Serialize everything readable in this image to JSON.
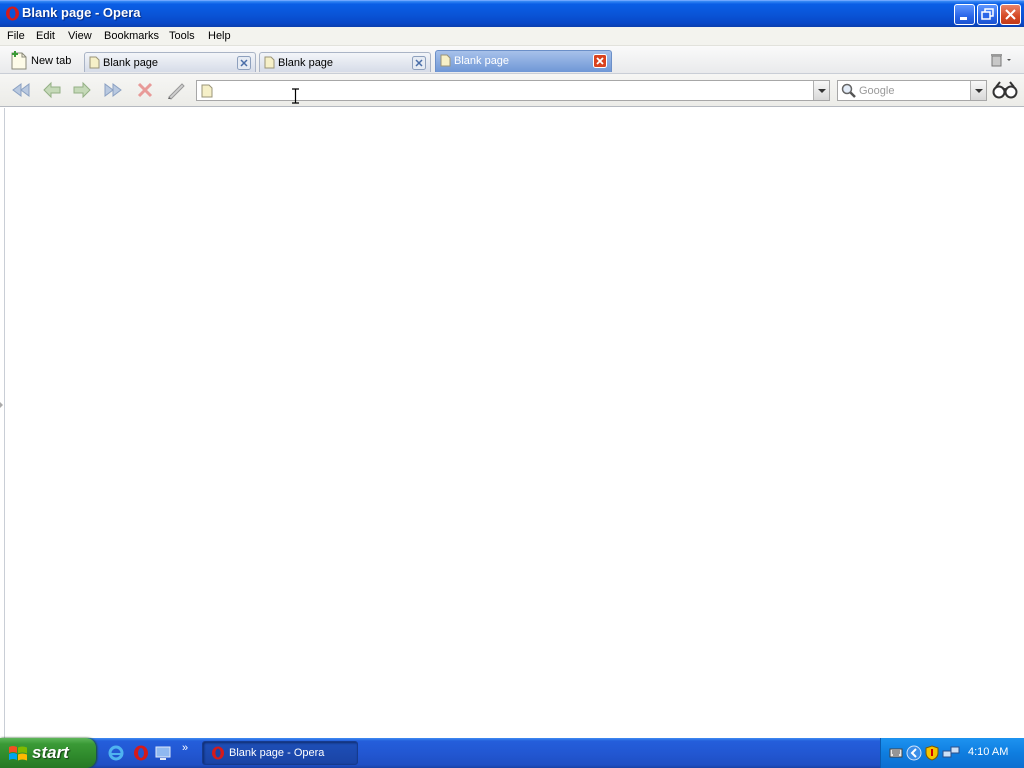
{
  "window": {
    "title": "Blank page - Opera",
    "icons": [
      "opera-logo-icon",
      "minimize-icon",
      "restore-icon",
      "close-icon"
    ]
  },
  "menu": {
    "items": [
      "File",
      "Edit",
      "View",
      "Bookmarks",
      "Tools",
      "Help"
    ]
  },
  "tabs": {
    "new_tab_label": "New tab",
    "items": [
      {
        "label": "Blank page",
        "active": false
      },
      {
        "label": "Blank page",
        "active": false
      },
      {
        "label": "Blank page",
        "active": true
      }
    ]
  },
  "toolbar": {
    "buttons": [
      "rewind-icon",
      "back-icon",
      "forward-icon",
      "fast-forward-icon",
      "stop-icon",
      "edit-icon"
    ],
    "address_value": "",
    "search_placeholder": "Google"
  },
  "taskbar": {
    "start_label": "start",
    "quick_launch": [
      "internet-explorer-icon",
      "opera-icon",
      "show-desktop-icon"
    ],
    "more_label": "»",
    "task_label": "Blank page - Opera",
    "clock": "4:10 AM"
  },
  "colors": {
    "titlebar": "#0a55d8",
    "start_button": "#3a9a36",
    "active_tab": "#6f97d6",
    "close_button": "#d54a25"
  }
}
